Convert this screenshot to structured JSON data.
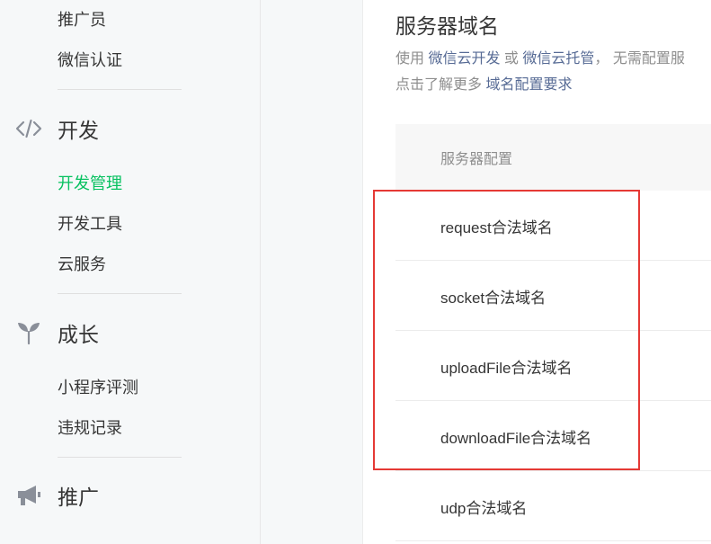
{
  "sidebar": {
    "group_prev": {
      "items": [
        {
          "label": "推广员"
        },
        {
          "label": "微信认证"
        }
      ]
    },
    "dev": {
      "title": "开发",
      "icon": "code-icon",
      "items": [
        {
          "label": "开发管理",
          "active": true
        },
        {
          "label": "开发工具"
        },
        {
          "label": "云服务"
        }
      ]
    },
    "growth": {
      "title": "成长",
      "icon": "sprout-icon",
      "items": [
        {
          "label": "小程序评测"
        },
        {
          "label": "违规记录"
        }
      ]
    },
    "promo": {
      "title": "推广",
      "icon": "megaphone-icon"
    }
  },
  "main": {
    "title": "服务器域名",
    "desc": {
      "prefix": "使用 ",
      "link1": "微信云开发",
      "or": " 或 ",
      "link2": "微信云托管",
      "suffix": "， 无需配置服",
      "line2_prefix": "点击了解更多 ",
      "line2_link": "域名配置要求"
    },
    "table": {
      "header": "服务器配置",
      "rows": [
        {
          "label": "request合法域名"
        },
        {
          "label": "socket合法域名"
        },
        {
          "label": "uploadFile合法域名"
        },
        {
          "label": "downloadFile合法域名"
        },
        {
          "label": "udp合法域名"
        }
      ]
    }
  },
  "colors": {
    "active": "#07c160",
    "link": "#576b95",
    "highlight": "#e53935"
  }
}
